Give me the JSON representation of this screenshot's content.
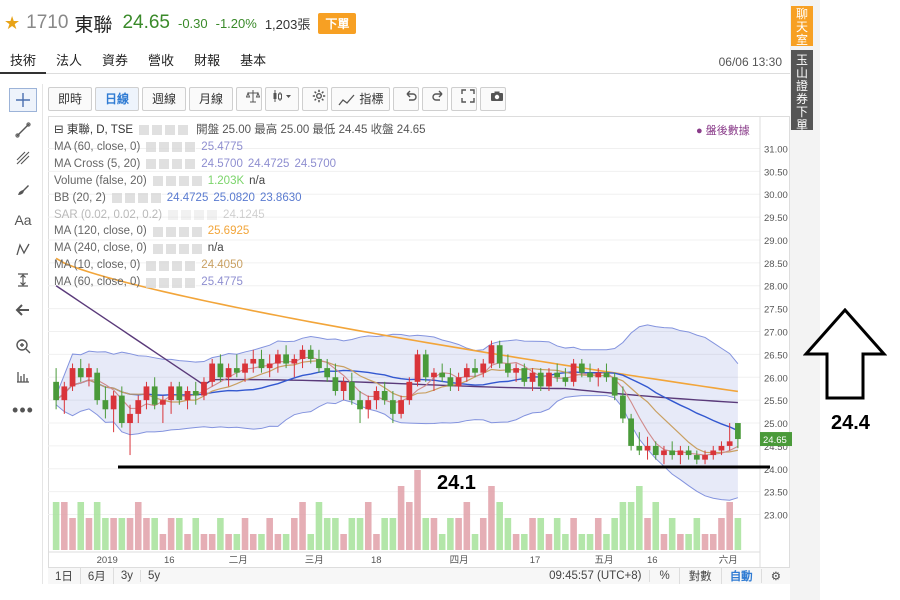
{
  "header": {
    "code": "1710",
    "name": "東聯",
    "price": "24.65",
    "change": "-0.30",
    "change_pct": "-1.20%",
    "volume": "1,203張",
    "order_label": "下單"
  },
  "tabs": [
    "技術",
    "法人",
    "資券",
    "營收",
    "財報",
    "基本"
  ],
  "clock": "06/06 13:30",
  "side": {
    "chat": "聊天室",
    "order": "玉山證券下單"
  },
  "toolbar": {
    "buttons": [
      "即時",
      "日線",
      "週線",
      "月線"
    ],
    "indicator_label": "指標"
  },
  "legend": {
    "title": "東聯, D, TSE",
    "ohlc_text": "開盤 25.00 最高 25.00 最低 24.45 收盤 24.65",
    "rows": [
      {
        "label": "MA (60, close, 0)",
        "values": [
          "25.4775"
        ],
        "colors": [
          "#8e8ed0"
        ]
      },
      {
        "label": "MA Cross (5, 20)",
        "values": [
          "24.5700",
          "24.4725",
          "24.5700"
        ],
        "colors": [
          "#8e8ed0",
          "#8e8ed0",
          "#8e8ed0"
        ]
      },
      {
        "label": "Volume (false, 20)",
        "values": [
          "1.203K",
          "n/a"
        ],
        "colors": [
          "#7bd46a",
          "#444"
        ]
      },
      {
        "label": "BB (20, 2)",
        "values": [
          "24.4725",
          "25.0820",
          "23.8630"
        ],
        "colors": [
          "#5a7bd0",
          "#5a7bd0",
          "#5a7bd0"
        ]
      },
      {
        "label": "SAR (0.02, 0.02, 0.2)",
        "values": [
          "24.1245"
        ],
        "colors": [
          "#999"
        ]
      },
      {
        "label": "MA (120, close, 0)",
        "values": [
          "25.6925"
        ],
        "colors": [
          "#f2a53a"
        ]
      },
      {
        "label": "MA (240, close, 0)",
        "values": [
          "n/a"
        ],
        "colors": [
          "#444"
        ]
      },
      {
        "label": "MA (10, close, 0)",
        "values": [
          "24.4050"
        ],
        "colors": [
          "#c9a062"
        ]
      },
      {
        "label": "MA (60, close, 0)",
        "values": [
          "25.4775"
        ],
        "colors": [
          "#8e8ed0"
        ]
      }
    ]
  },
  "after_hours": "● 盤後數據",
  "bottom": {
    "ranges": [
      "1日",
      "6月",
      "3y",
      "5y"
    ],
    "time": "09:45:57 (UTC+8)",
    "percent": "%",
    "log": "對數",
    "auto": "自動"
  },
  "annotations": {
    "right": "24.4",
    "middle": "24.1"
  },
  "chart_data": {
    "type": "candlestick",
    "y_ticks": [
      "31.00",
      "30.50",
      "30.00",
      "29.50",
      "29.00",
      "28.50",
      "28.00",
      "27.50",
      "27.00",
      "26.50",
      "26.00",
      "25.50",
      "25.00",
      "24.50",
      "24.00",
      "23.50",
      "23.00"
    ],
    "ylim": [
      22.75,
      31.25
    ],
    "x_labels": [
      "2019",
      "16",
      "二月",
      "三月",
      "18",
      "四月",
      "17",
      "五月",
      "16",
      "六月"
    ],
    "last_price": "24.65",
    "ohlc": [
      [
        25.9,
        26.2,
        25.3,
        25.5
      ],
      [
        25.5,
        25.9,
        25.2,
        25.8
      ],
      [
        25.8,
        26.3,
        25.7,
        26.2
      ],
      [
        26.2,
        26.4,
        25.9,
        26.0
      ],
      [
        26.0,
        26.3,
        25.8,
        26.2
      ],
      [
        26.1,
        26.2,
        25.4,
        25.5
      ],
      [
        25.5,
        25.8,
        25.1,
        25.3
      ],
      [
        25.3,
        25.7,
        24.8,
        25.6
      ],
      [
        25.6,
        25.8,
        24.9,
        25.0
      ],
      [
        25.0,
        25.4,
        24.3,
        25.2
      ],
      [
        25.2,
        25.6,
        25.0,
        25.5
      ],
      [
        25.5,
        25.9,
        25.3,
        25.8
      ],
      [
        25.8,
        26.0,
        25.3,
        25.4
      ],
      [
        25.4,
        25.6,
        25.0,
        25.5
      ],
      [
        25.5,
        25.9,
        25.2,
        25.8
      ],
      [
        25.8,
        25.9,
        25.4,
        25.5
      ],
      [
        25.5,
        25.8,
        25.3,
        25.7
      ],
      [
        25.7,
        25.9,
        25.4,
        25.6
      ],
      [
        25.6,
        26.0,
        25.5,
        25.9
      ],
      [
        25.9,
        26.4,
        25.8,
        26.3
      ],
      [
        26.3,
        26.5,
        25.9,
        26.0
      ],
      [
        26.0,
        26.3,
        25.8,
        26.2
      ],
      [
        26.2,
        26.5,
        26.0,
        26.1
      ],
      [
        26.1,
        26.4,
        25.9,
        26.3
      ],
      [
        26.3,
        26.6,
        26.1,
        26.4
      ],
      [
        26.4,
        26.6,
        26.1,
        26.2
      ],
      [
        26.2,
        26.5,
        26.0,
        26.3
      ],
      [
        26.3,
        26.6,
        26.1,
        26.5
      ],
      [
        26.5,
        26.7,
        26.2,
        26.3
      ],
      [
        26.3,
        26.5,
        26.0,
        26.4
      ],
      [
        26.4,
        26.7,
        26.2,
        26.6
      ],
      [
        26.6,
        26.7,
        26.3,
        26.4
      ],
      [
        26.4,
        26.6,
        26.1,
        26.2
      ],
      [
        26.2,
        26.4,
        25.9,
        26.0
      ],
      [
        26.0,
        26.3,
        25.6,
        25.7
      ],
      [
        25.7,
        26.0,
        25.5,
        25.9
      ],
      [
        25.9,
        26.1,
        25.4,
        25.5
      ],
      [
        25.5,
        25.7,
        25.0,
        25.3
      ],
      [
        25.3,
        25.6,
        25.1,
        25.5
      ],
      [
        25.5,
        25.8,
        25.3,
        25.7
      ],
      [
        25.7,
        25.9,
        25.4,
        25.5
      ],
      [
        25.5,
        25.7,
        25.0,
        25.2
      ],
      [
        25.2,
        25.6,
        25.1,
        25.5
      ],
      [
        25.5,
        26.0,
        25.4,
        25.9
      ],
      [
        25.9,
        26.6,
        25.8,
        26.5
      ],
      [
        26.5,
        26.6,
        25.9,
        26.0
      ],
      [
        26.0,
        26.2,
        25.7,
        26.1
      ],
      [
        26.1,
        26.3,
        25.9,
        26.0
      ],
      [
        26.0,
        26.2,
        25.7,
        25.8
      ],
      [
        25.8,
        26.1,
        25.7,
        26.0
      ],
      [
        26.0,
        26.3,
        25.9,
        26.2
      ],
      [
        26.2,
        26.4,
        26.0,
        26.1
      ],
      [
        26.1,
        26.4,
        26.0,
        26.3
      ],
      [
        26.3,
        26.8,
        26.2,
        26.7
      ],
      [
        26.7,
        26.8,
        26.2,
        26.3
      ],
      [
        26.3,
        26.5,
        26.0,
        26.1
      ],
      [
        26.1,
        26.3,
        25.9,
        26.2
      ],
      [
        26.2,
        26.3,
        25.8,
        25.9
      ],
      [
        25.9,
        26.2,
        25.7,
        26.1
      ],
      [
        26.1,
        26.2,
        25.7,
        25.8
      ],
      [
        25.8,
        26.2,
        25.7,
        26.1
      ],
      [
        26.1,
        26.3,
        25.9,
        26.0
      ],
      [
        26.0,
        26.2,
        25.8,
        25.9
      ],
      [
        25.9,
        26.4,
        25.8,
        26.3
      ],
      [
        26.3,
        26.4,
        26.0,
        26.1
      ],
      [
        26.1,
        26.3,
        25.9,
        26.0
      ],
      [
        26.0,
        26.2,
        25.8,
        26.1
      ],
      [
        26.1,
        26.3,
        25.9,
        26.0
      ],
      [
        26.0,
        26.1,
        25.5,
        25.6
      ],
      [
        25.6,
        25.8,
        25.0,
        25.1
      ],
      [
        25.1,
        25.2,
        24.4,
        24.5
      ],
      [
        24.5,
        24.8,
        24.3,
        24.4
      ],
      [
        24.4,
        24.7,
        24.2,
        24.5
      ],
      [
        24.5,
        24.6,
        24.2,
        24.3
      ],
      [
        24.3,
        24.5,
        24.1,
        24.4
      ],
      [
        24.4,
        24.6,
        24.2,
        24.3
      ],
      [
        24.3,
        24.5,
        24.1,
        24.4
      ],
      [
        24.4,
        24.5,
        24.2,
        24.3
      ],
      [
        24.3,
        24.4,
        24.1,
        24.2
      ],
      [
        24.2,
        24.4,
        24.1,
        24.3
      ],
      [
        24.3,
        24.5,
        24.2,
        24.4
      ],
      [
        24.4,
        24.6,
        24.3,
        24.5
      ],
      [
        24.5,
        25.0,
        24.4,
        24.6
      ],
      [
        25.0,
        25.0,
        24.45,
        24.65
      ]
    ],
    "volume": [
      3,
      3,
      2,
      3,
      2,
      3,
      2,
      2,
      2,
      2,
      3,
      2,
      2,
      1,
      2,
      2,
      1,
      2,
      1,
      1,
      2,
      1,
      1,
      2,
      1,
      1,
      2,
      1,
      1,
      2,
      3,
      1,
      3,
      2,
      2,
      1,
      2,
      2,
      3,
      1,
      2,
      2,
      4,
      3,
      5,
      2,
      2,
      1,
      2,
      2,
      3,
      1,
      2,
      4,
      3,
      2,
      1,
      1,
      2,
      2,
      1,
      2,
      1,
      2,
      1,
      1,
      2,
      1,
      2,
      3,
      3,
      4,
      2,
      3,
      1,
      2,
      1,
      1,
      2,
      1,
      1,
      2,
      3,
      2
    ],
    "annotated_levels": [
      "24.1",
      "24.4"
    ]
  }
}
